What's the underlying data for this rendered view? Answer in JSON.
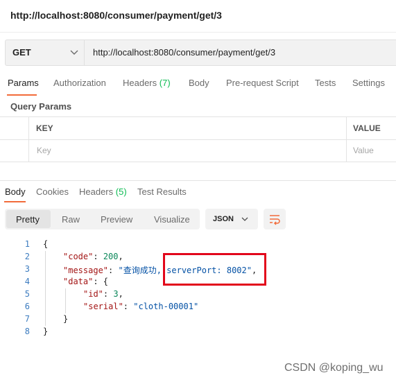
{
  "request": {
    "title": "http://localhost:8080/consumer/payment/get/3",
    "method": "GET",
    "url": "http://localhost:8080/consumer/payment/get/3"
  },
  "request_tabs": {
    "params": "Params",
    "authorization": "Authorization",
    "headers": "Headers",
    "headers_count": "(7)",
    "body": "Body",
    "prerequest": "Pre-request Script",
    "tests": "Tests",
    "settings": "Settings"
  },
  "query_params": {
    "title": "Query Params",
    "col_key": "KEY",
    "col_value": "VALUE",
    "key_placeholder": "Key",
    "value_placeholder": "Value"
  },
  "response_tabs": {
    "body": "Body",
    "cookies": "Cookies",
    "headers": "Headers",
    "headers_count": "(5)",
    "test_results": "Test Results"
  },
  "view_modes": {
    "pretty": "Pretty",
    "raw": "Raw",
    "preview": "Preview",
    "visualize": "Visualize",
    "format": "JSON"
  },
  "code": {
    "line_numbers": [
      "1",
      "2",
      "3",
      "4",
      "5",
      "6",
      "7",
      "8"
    ],
    "open_brace": "{",
    "code_key": "\"code\"",
    "code_value": "200",
    "message_key": "\"message\"",
    "message_value": "\"查询成功, serverPort: 8002\"",
    "data_key": "\"data\"",
    "id_key": "\"id\"",
    "id_value": "3",
    "serial_key": "\"serial\"",
    "serial_value": "\"cloth-00001\"",
    "inner_close": "}",
    "close_brace": "}"
  },
  "watermark": "CSDN @koping_wu",
  "colors": {
    "accent": "#f26b3a",
    "count_green": "#0cbb52",
    "highlight_box": "#e2061b"
  }
}
